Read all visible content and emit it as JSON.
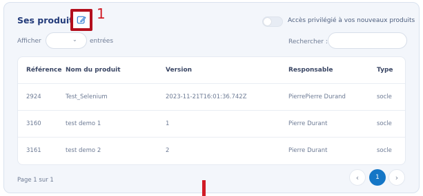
{
  "header": {
    "title": "Ses produits",
    "annotation_number": "1",
    "annotation_color": "#d11b25",
    "edit_icon": "edit-icon",
    "toggle_label": "Accès privilégié à vos nouveaux produits",
    "toggle_on": false
  },
  "filters": {
    "show_label": "Afficher",
    "entries_value": "",
    "entries_label": "entrées",
    "search_label": "Rechercher :",
    "search_value": ""
  },
  "table": {
    "columns": [
      "Référence",
      "Nom du produit",
      "Version",
      "Responsable",
      "Type"
    ],
    "rows": [
      [
        "2924",
        "Test_Selenium",
        "2023-11-21T16:01:36.742Z",
        "PierrePierre Durand",
        "socle"
      ],
      [
        "3160",
        "test demo 1",
        "1",
        "Pierre Durant",
        "socle"
      ],
      [
        "3161",
        "test demo 2",
        "2",
        "Pierre Durant",
        "socle"
      ]
    ]
  },
  "pagination": {
    "info": "Page 1 sur 1",
    "current_page": "1",
    "prev_icon": "chevron-left-icon",
    "next_icon": "chevron-right-icon"
  },
  "colors": {
    "accent": "#1476c6",
    "title": "#233b7a",
    "highlight_border": "#b30f1d"
  }
}
